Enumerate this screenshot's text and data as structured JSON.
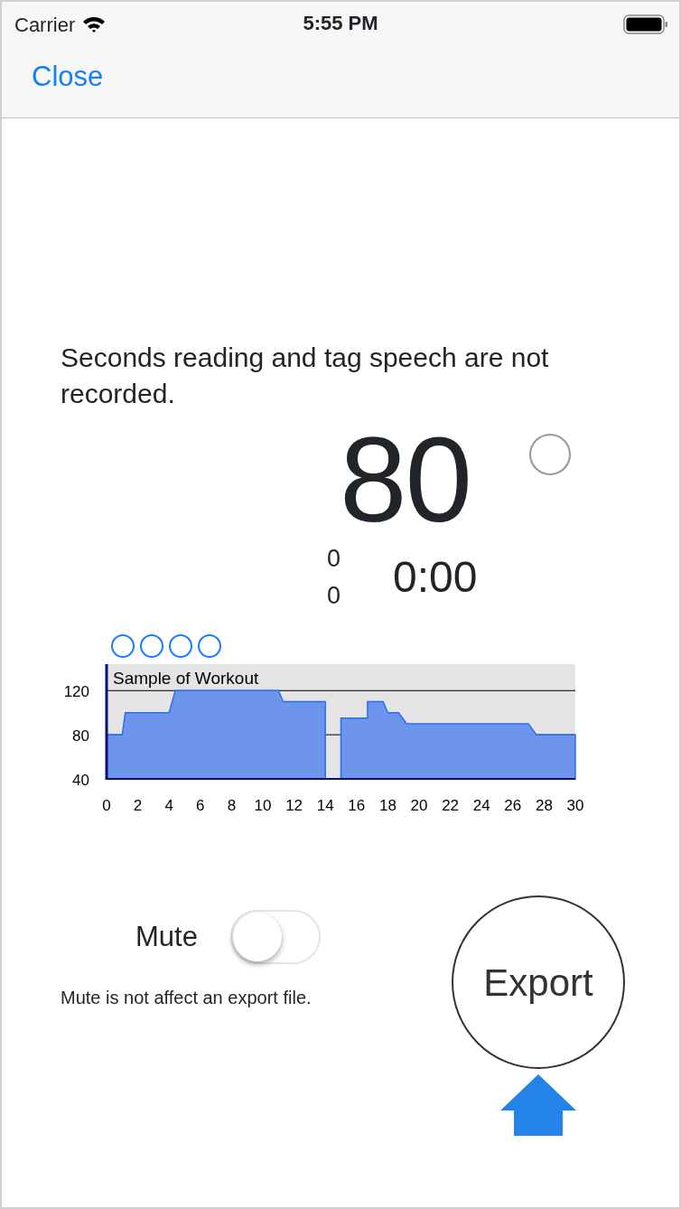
{
  "status_bar": {
    "carrier": "Carrier",
    "time": "5:55 PM"
  },
  "nav_bar": {
    "close": "Close"
  },
  "message": "Seconds reading and tag speech are not recorded.",
  "reading": {
    "value": "80",
    "status_light": {
      "on": false
    },
    "counter_1": "0",
    "counter_2": "0",
    "elapsed": "0:00"
  },
  "markers": [
    {
      "filled": false
    },
    {
      "filled": false
    },
    {
      "filled": false
    },
    {
      "filled": false
    }
  ],
  "chart": {
    "chart_data": {
      "type": "area",
      "title": "Sample of Workout",
      "x": [
        0,
        1,
        1.2,
        4,
        4.4,
        11,
        11.3,
        14,
        14,
        15,
        15,
        16.7,
        16.7,
        17.7,
        18,
        18.7,
        19.2,
        27,
        27.5,
        30
      ],
      "series": [
        {
          "color": "#6d95ec",
          "values": [
            80,
            80,
            100,
            100,
            120,
            120,
            110,
            110,
            40,
            40,
            95,
            95,
            110,
            110,
            100,
            100,
            90,
            90,
            80,
            80
          ]
        }
      ],
      "xlim": [
        0,
        30
      ],
      "ylim": [
        40,
        144
      ],
      "xticks": [
        0,
        2,
        4,
        6,
        8,
        10,
        12,
        14,
        16,
        18,
        20,
        22,
        24,
        26,
        28,
        30
      ],
      "yticks": [
        40,
        80,
        120
      ]
    }
  },
  "mute": {
    "label": "Mute",
    "on": false,
    "note": "Mute is not affect an export file."
  },
  "export_button": "Export"
}
